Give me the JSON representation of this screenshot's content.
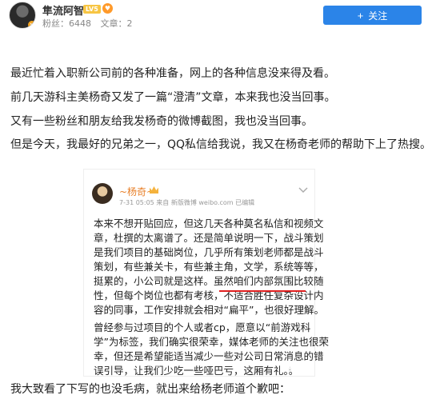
{
  "header": {
    "author_name": "隼流阿智",
    "level_badge": "LV5",
    "fans_label": "粉丝：6448",
    "articles_label": "文章：2",
    "follow_label": "关注",
    "follow_plus": "+"
  },
  "article": {
    "paragraphs": [
      "最近忙着入职新公司前的各种准备，网上的各种信息没来得及看。",
      "前几天游科主美杨奇又发了一篇“澄清”文章，本来我也没当回事。",
      "又有一些粉丝和朋友给我发杨奇的微博截图，我也没当回事。",
      "但是今天，我最好的兄弟之一，QQ私信给我说，我又在杨奇老师的帮助下上了热搜。"
    ],
    "footer": "我大致看了下写的也没毛病，就出来给杨老师道个歉吧："
  },
  "quote": {
    "name": "~杨奇~",
    "meta": "7-31 05:05  来自 新版微博 weibo.com  已编辑",
    "lines": [
      "本来不想开贴回应，但这几天各种莫名私信和视频文",
      "章，杜撰的太离谱了。还是简单说明一下，战斗策划",
      "是我们项目的基础岗位，几乎所有策划老师都是战斗",
      "策划，有些兼关卡，有些兼主角，文学，系统等等，",
      "挺累的，小公司就是这样。虽然咱们内部氛围比较随",
      "性，但每个岗位也都有考核，不适合胜任复杂设计内",
      "容的同事，工作安排就会相对“扁平”，也很好理解。",
      "  曾经参与过项目的个人或者cp，愿意以“前游戏科",
      "学”为标签，我们确实很荣幸，媒体老师的关注也很荣",
      "幸，但还是希望能适当减少一些对公司日常消息的错",
      "误引导，让我们少吃一些哑巴亏，这厢有礼。。"
    ],
    "end_glyph": "🕯"
  },
  "colors": {
    "accent": "#2b84e8",
    "quote_name": "#e8802a",
    "underline": "#e02020"
  }
}
